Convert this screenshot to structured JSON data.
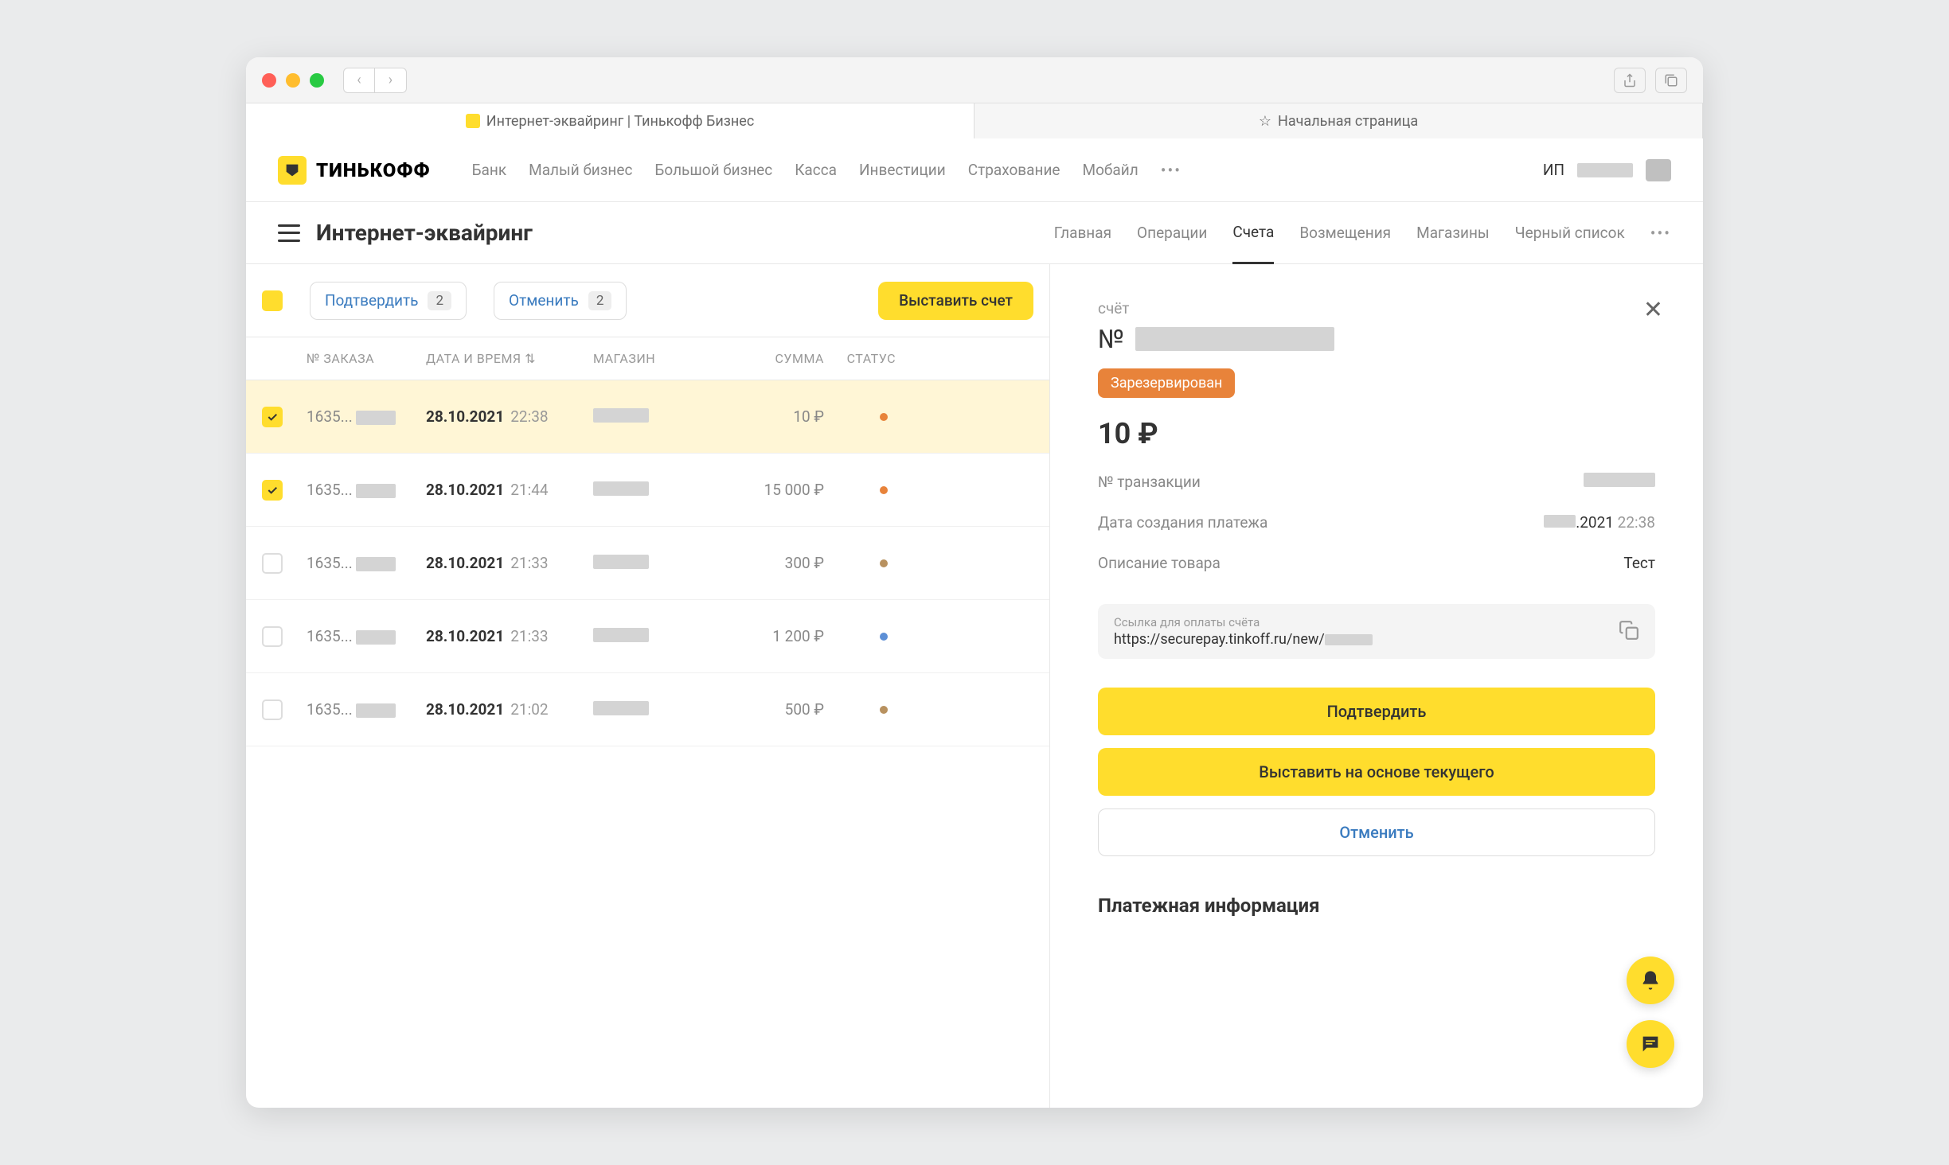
{
  "browser": {
    "tabs": [
      {
        "title": "Интернет-эквайринг | Тинькофф Бизнес",
        "active": true
      },
      {
        "title": "Начальная страница",
        "active": false
      }
    ]
  },
  "brand": "ТИНЬКОФФ",
  "topnav": [
    "Банк",
    "Малый бизнес",
    "Большой бизнес",
    "Касса",
    "Инвестиции",
    "Страхование",
    "Мобайл"
  ],
  "user_prefix": "ИП",
  "page_title": "Интернет-эквайринг",
  "subnav": [
    {
      "label": "Главная",
      "active": false
    },
    {
      "label": "Операции",
      "active": false
    },
    {
      "label": "Счета",
      "active": true
    },
    {
      "label": "Возмещения",
      "active": false
    },
    {
      "label": "Магазины",
      "active": false
    },
    {
      "label": "Черный список",
      "active": false
    }
  ],
  "toolbar": {
    "confirm": "Подтвердить",
    "confirm_count": "2",
    "cancel": "Отменить",
    "cancel_count": "2",
    "create": "Выставить счет"
  },
  "columns": {
    "order": "№ ЗАКАЗА",
    "datetime": "ДАТА И ВРЕМЯ",
    "shop": "МАГАЗИН",
    "sum": "СУММА",
    "status": "СТАТУС"
  },
  "rows": [
    {
      "checked": true,
      "selected": true,
      "order": "1635...",
      "date": "28.10.2021",
      "time": "22:38",
      "sum": "10 ₽",
      "dot": "orange"
    },
    {
      "checked": true,
      "selected": false,
      "order": "1635...",
      "date": "28.10.2021",
      "time": "21:44",
      "sum": "15 000 ₽",
      "dot": "orange"
    },
    {
      "checked": false,
      "selected": false,
      "order": "1635...",
      "date": "28.10.2021",
      "time": "21:33",
      "sum": "300 ₽",
      "dot": "brown"
    },
    {
      "checked": false,
      "selected": false,
      "order": "1635...",
      "date": "28.10.2021",
      "time": "21:33",
      "sum": "1 200 ₽",
      "dot": "blue"
    },
    {
      "checked": false,
      "selected": false,
      "order": "1635...",
      "date": "28.10.2021",
      "time": "21:02",
      "sum": "500 ₽",
      "dot": "brown"
    }
  ],
  "detail": {
    "heading": "счёт",
    "num_prefix": "№",
    "status": "Зарезервирован",
    "amount": "10 ₽",
    "fields": {
      "transaction_label": "№ транзакции",
      "date_label": "Дата создания платежа",
      "date_value_suffix": ".2021",
      "date_time": "22:38",
      "desc_label": "Описание товара",
      "desc_value": "Тест"
    },
    "link": {
      "label": "Ссылка для оплаты счёта",
      "url": "https://securepay.tinkoff.ru/new/"
    },
    "actions": {
      "confirm": "Подтвердить",
      "clone": "Выставить на основе текущего",
      "cancel": "Отменить"
    },
    "payment_info": "Платежная информация"
  }
}
